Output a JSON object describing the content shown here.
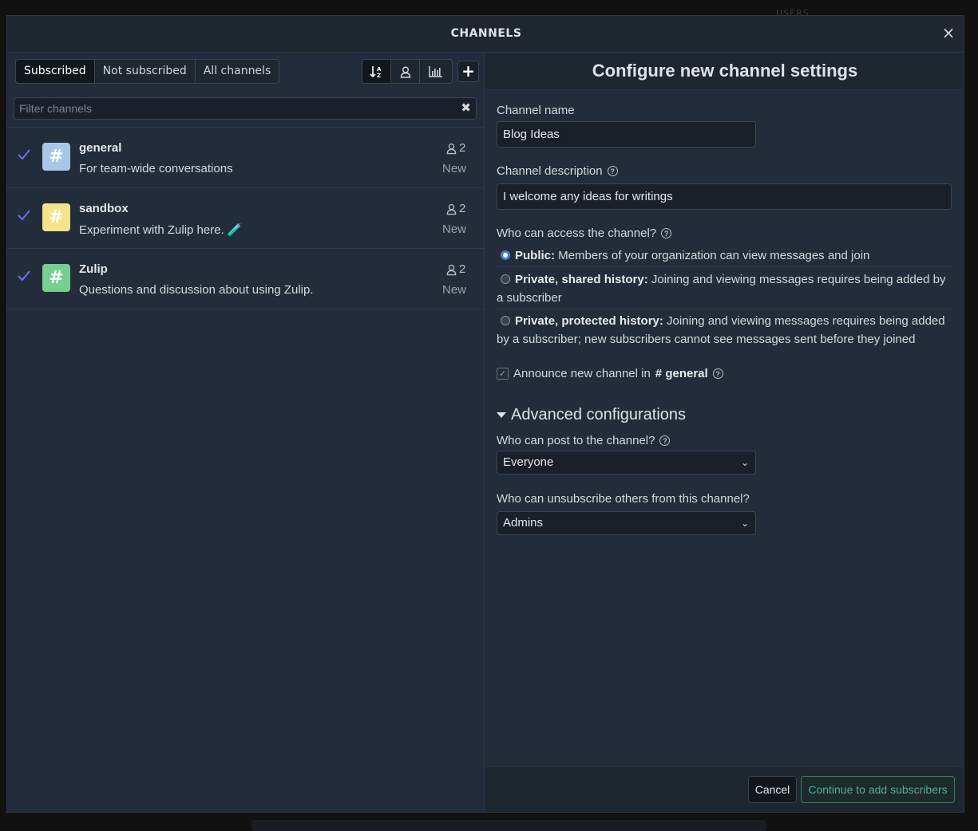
{
  "background": {
    "users_label": "USERS"
  },
  "modal": {
    "title": "CHANNELS",
    "close_icon": "×"
  },
  "tabs": [
    {
      "label": "Subscribed",
      "active": true
    },
    {
      "label": "Not subscribed",
      "active": false
    },
    {
      "label": "All channels",
      "active": false
    }
  ],
  "sort_icons": [
    "sort-alpha-icon",
    "subscribers-icon",
    "weekly-traffic-icon"
  ],
  "add_button": "+",
  "filter": {
    "placeholder": "Filter channels",
    "value": "",
    "clear_icon": "✖"
  },
  "channels": [
    {
      "name": "general",
      "description": "For team-wide conversations",
      "subscribers": "2",
      "status": "New",
      "color": "#a6c7e5",
      "subscribed": true
    },
    {
      "name": "sandbox",
      "description": "Experiment with Zulip here. 🧪",
      "subscribers": "2",
      "status": "New",
      "color": "#f5e389",
      "subscribed": true
    },
    {
      "name": "Zulip",
      "description": "Questions and discussion about using Zulip.",
      "subscribers": "2",
      "status": "New",
      "color": "#76ce90",
      "subscribed": true
    }
  ],
  "settings": {
    "title": "Configure new channel settings",
    "name_label": "Channel name",
    "name_value": "Blog Ideas",
    "description_label": "Channel description",
    "description_value": "I welcome any ideas for writings",
    "access_label": "Who can access the channel?",
    "access_options": [
      {
        "title": "Public:",
        "text": " Members of your organization can view messages and join",
        "selected": true
      },
      {
        "title": "Private, shared history:",
        "text": " Joining and viewing messages requires being added by a subscriber",
        "selected": false
      },
      {
        "title": "Private, protected history:",
        "text": " Joining and viewing messages requires being added by a subscriber; new subscribers cannot see messages sent before they joined",
        "selected": false
      }
    ],
    "announce_prefix": "Announce new channel in",
    "announce_channel": "general",
    "announce_checked": true,
    "advanced_label": "Advanced configurations",
    "post_label": "Who can post to the channel?",
    "post_value": "Everyone",
    "unsubscribe_label": "Who can unsubscribe others from this channel?",
    "unsubscribe_value": "Admins",
    "cancel_label": "Cancel",
    "continue_label": "Continue to add subscribers"
  },
  "colors": {
    "accent": "#4a7bd8",
    "check": "#6f6ef0",
    "continue": "#4fae93"
  }
}
